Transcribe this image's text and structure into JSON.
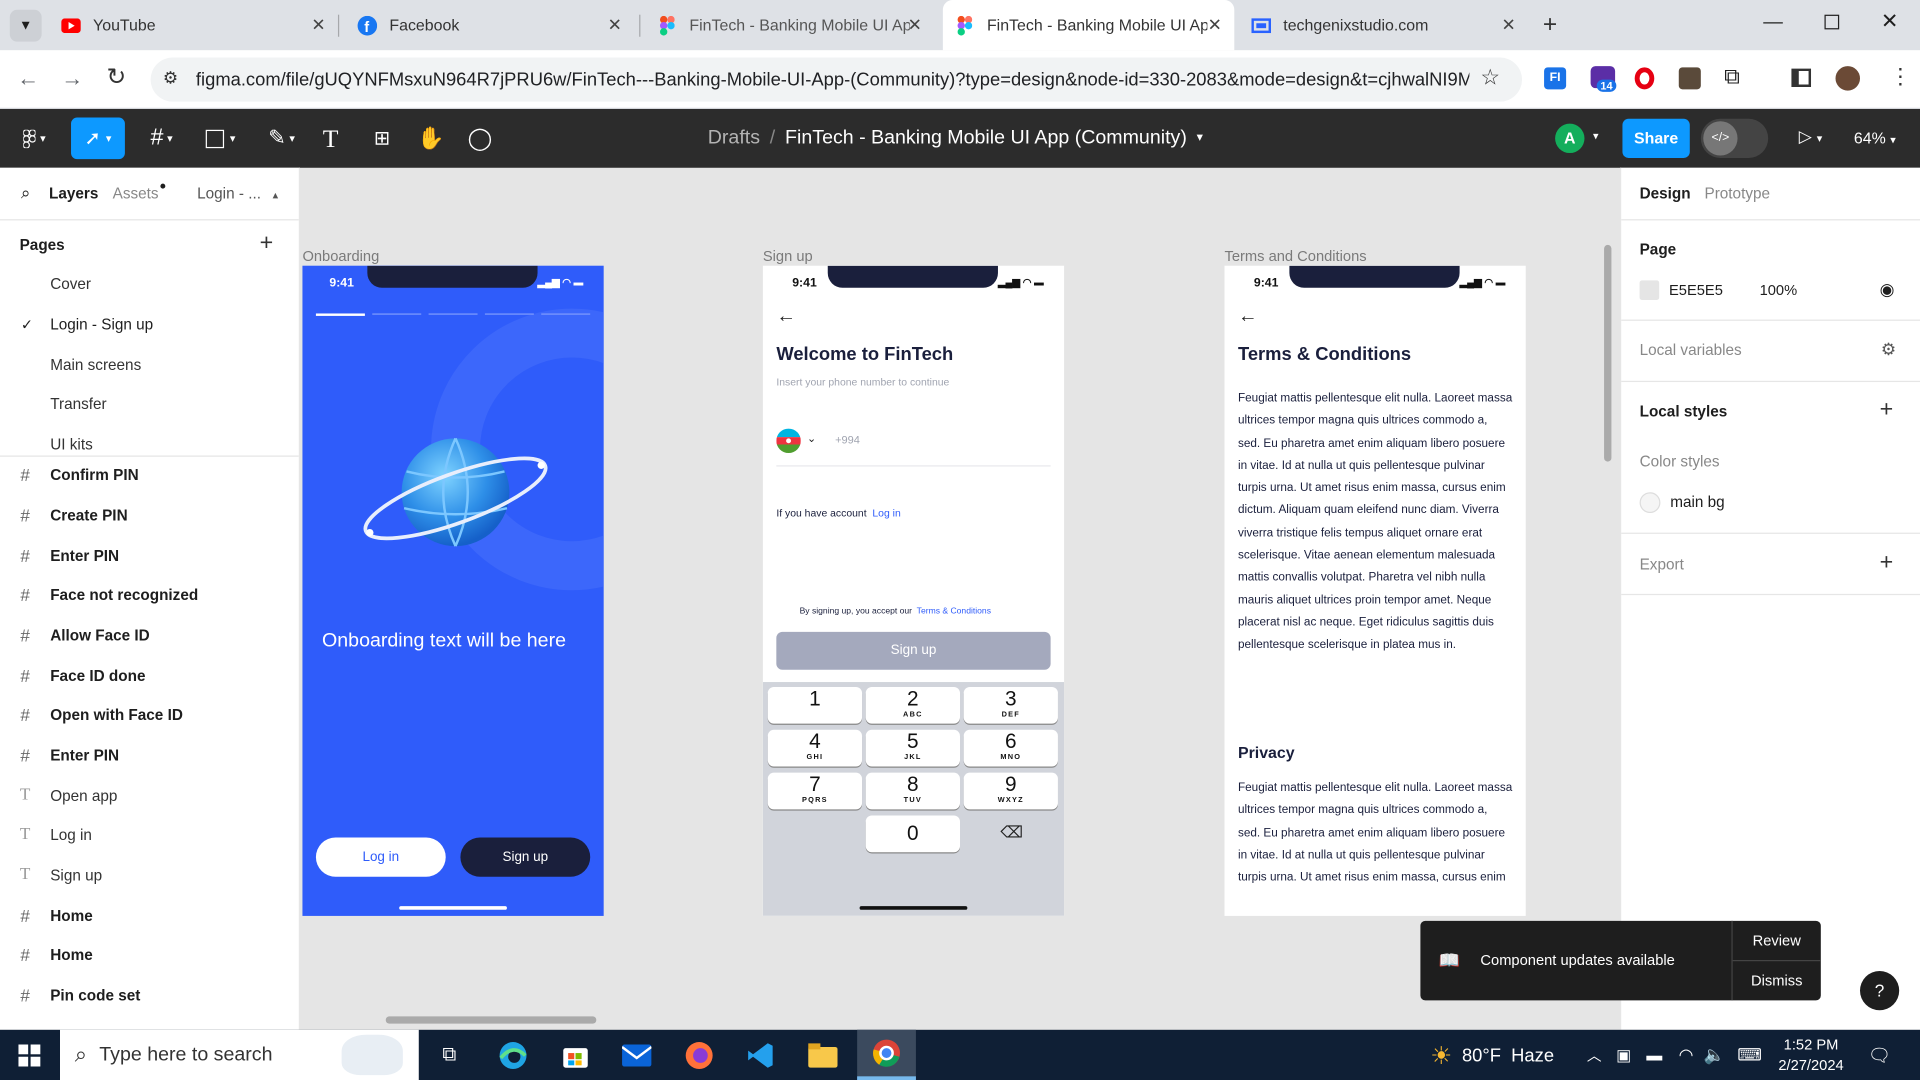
{
  "browser": {
    "tabs": [
      {
        "title": "YouTube",
        "icon": "youtube-icon",
        "active": false
      },
      {
        "title": "Facebook",
        "icon": "facebook-icon",
        "active": false
      },
      {
        "title": "FinTech - Banking Mobile UI Ap",
        "icon": "figma-icon",
        "active": false
      },
      {
        "title": "FinTech - Banking Mobile UI Ap",
        "icon": "figma-icon",
        "active": true
      },
      {
        "title": "techgenixstudio.com",
        "icon": "site-icon",
        "active": false
      }
    ],
    "url": "figma.com/file/gUQYNFMsxuN964R7jPRU6w/FinTech---Banking-Mobile-UI-App-(Community)?type=design&node-id=330-2083&mode=design&t=cjhwalNI9MhtP...",
    "extension_badge": "14"
  },
  "figma": {
    "breadcrumb_root": "Drafts",
    "breadcrumb_sep": "/",
    "file_name": "FinTech - Banking Mobile UI App (Community)",
    "avatar_letter": "A",
    "share_label": "Share",
    "zoom": "64%",
    "left": {
      "tabs": {
        "layers": "Layers",
        "assets": "Assets",
        "page": "Login - ..."
      },
      "pages_title": "Pages",
      "pages": [
        "Cover",
        "Login - Sign up",
        "Main screens",
        "Transfer",
        "UI kits"
      ],
      "layers": [
        {
          "name": "Confirm PIN",
          "kind": "frame"
        },
        {
          "name": "Create PIN",
          "kind": "frame"
        },
        {
          "name": "Enter PIN",
          "kind": "frame"
        },
        {
          "name": "Face not recognized",
          "kind": "frame"
        },
        {
          "name": "Allow Face ID",
          "kind": "frame"
        },
        {
          "name": "Face ID done",
          "kind": "frame"
        },
        {
          "name": "Open with Face ID",
          "kind": "frame"
        },
        {
          "name": "Enter PIN",
          "kind": "frame"
        },
        {
          "name": "Open app",
          "kind": "text"
        },
        {
          "name": "Log in",
          "kind": "text"
        },
        {
          "name": "Sign up",
          "kind": "text"
        },
        {
          "name": "Home",
          "kind": "frame"
        },
        {
          "name": "Home",
          "kind": "frame"
        },
        {
          "name": "Pin code set",
          "kind": "frame"
        }
      ]
    },
    "right": {
      "tabs": {
        "design": "Design",
        "prototype": "Prototype"
      },
      "page_title": "Page",
      "page_color": "E5E5E5",
      "page_opacity": "100%",
      "local_variables": "Local variables",
      "local_styles": "Local styles",
      "color_styles": "Color styles",
      "style_name": "main bg",
      "export": "Export"
    },
    "canvas": {
      "frame_labels": [
        "Onboarding",
        "Sign up",
        "Terms and Conditions"
      ],
      "time": "9:41",
      "onboarding": {
        "text": "Onboarding text will be here",
        "login": "Log in",
        "signup": "Sign up"
      },
      "signup": {
        "title": "Welcome to FinTech",
        "subtitle": "Insert your phone number to continue",
        "phone_code": "+994",
        "have_account": "If you have account",
        "login_link": "Log in",
        "terms_prefix": "By signing up, you accept our",
        "terms_link": "Terms & Conditions",
        "button": "Sign up",
        "keys": [
          {
            "n": "1",
            "l": ""
          },
          {
            "n": "2",
            "l": "ABC"
          },
          {
            "n": "3",
            "l": "DEF"
          },
          {
            "n": "4",
            "l": "GHI"
          },
          {
            "n": "5",
            "l": "JKL"
          },
          {
            "n": "6",
            "l": "MNO"
          },
          {
            "n": "7",
            "l": "PQRS"
          },
          {
            "n": "8",
            "l": "TUV"
          },
          {
            "n": "9",
            "l": "WXYZ"
          },
          {
            "n": "0",
            "l": ""
          }
        ]
      },
      "terms": {
        "title": "Terms & Conditions",
        "body": "Feugiat mattis pellentesque elit nulla. Laoreet massa ultrices tempor magna quis ultrices commodo a, sed. Eu pharetra amet enim aliquam libero posuere in vitae. Id at nulla ut quis pellentesque pulvinar turpis urna. Ut amet risus enim massa, cursus enim dictum. Aliquam quam eleifend nunc diam. Viverra viverra tristique felis tempus aliquet ornare erat scelerisque. Vitae aenean elementum malesuada mattis convallis volutpat. Pharetra vel nibh nulla mauris aliquet ultrices proin tempor amet. Neque placerat nisl ac neque. Eget ridiculus sagittis duis pellentesque scelerisque in platea mus in.",
        "privacy_title": "Privacy",
        "privacy_body": "Feugiat mattis pellentesque elit nulla. Laoreet massa ultrices tempor magna quis ultrices commodo a, sed. Eu pharetra amet enim aliquam libero posuere in vitae. Id at nulla ut quis pellentesque pulvinar turpis urna. Ut amet risus enim massa, cursus enim"
      }
    },
    "toast": {
      "text": "Component updates available",
      "review": "Review",
      "dismiss": "Dismiss"
    },
    "help": "?"
  },
  "taskbar": {
    "search_placeholder": "Type here to search",
    "weather": "80°F  Haze",
    "time": "1:52 PM",
    "date": "2/27/2024"
  },
  "colors": {
    "figma_blue": "#0d99ff",
    "onboarding_blue": "#2f5cfa",
    "navy": "#1a1f3c"
  }
}
